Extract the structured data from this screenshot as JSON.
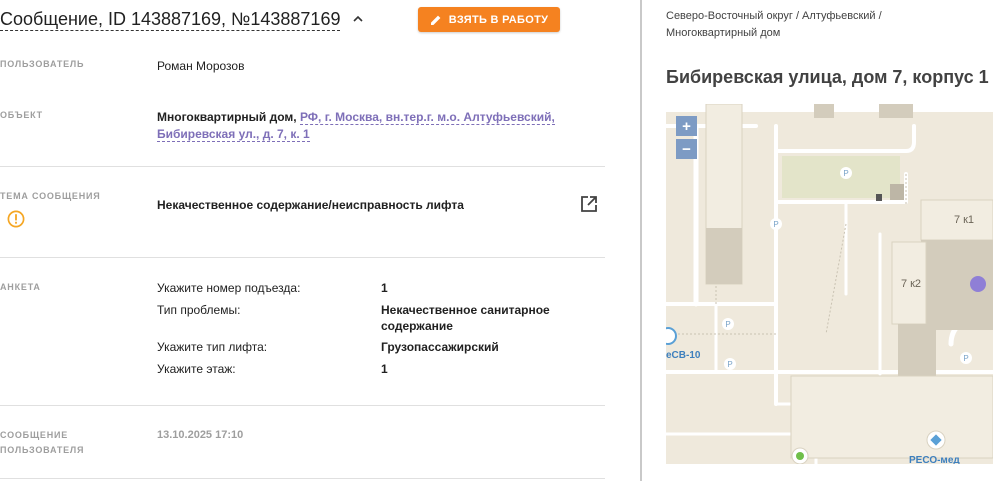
{
  "header": {
    "title": "Сообщение, ID 143887169, №143887169",
    "take_button_label": "ВЗЯТЬ В РАБОТУ"
  },
  "fields": {
    "user_label": "ПОЛЬЗОВАТЕЛЬ",
    "user_value": "Роман Морозов",
    "object_label": "ОБЪЕКТ",
    "object_type": "Многоквартирный дом,",
    "object_address_line1": "РФ, г. Москва, вн.тер.г. м.о. Алтуфьевский,",
    "object_address_line2": "Бибиревская ул., д. 7, к. 1",
    "topic_label": "ТЕМА СООБЩЕНИЯ",
    "topic_value": "Некачественное содержание/неисправность лифта",
    "survey_label": "АНКЕТА",
    "survey": [
      {
        "q": "Укажите номер подъезда:",
        "a": "1"
      },
      {
        "q": "Тип проблемы:",
        "a": "Некачественное санитарное содержание"
      },
      {
        "q": "Укажите тип лифта:",
        "a": "Грузопассажирский"
      },
      {
        "q": "Укажите этаж:",
        "a": "1"
      }
    ],
    "user_message_label_1": "СООБЩЕНИЕ",
    "user_message_label_2": "ПОЛЬЗОВАТЕЛЯ",
    "user_message_date": "13.10.2025 17:10"
  },
  "right": {
    "breadcrumb_line1": "Северо-Восточный округ / Алтуфьевский /",
    "breadcrumb_line2": "Многоквартирный дом",
    "address_title": "Бибиревская улица, дом 7, корпус 1"
  },
  "map": {
    "zoom_in": "+",
    "zoom_out": "−",
    "building_7k1": "7 к1",
    "building_7k2": "7 к2",
    "stop_label": "еСВ-10",
    "poi_label": "РЕСО-мед",
    "parking": "P"
  },
  "colors": {
    "accent_orange": "#f58220",
    "link_purple": "#7e6fb8",
    "marker_purple": "#8f7fd6",
    "warning": "#f5a623"
  },
  "icons": {
    "chevron": "chevron-up-icon",
    "pencil": "pencil-icon",
    "warning": "warning-circle-icon",
    "external": "external-link-icon"
  }
}
